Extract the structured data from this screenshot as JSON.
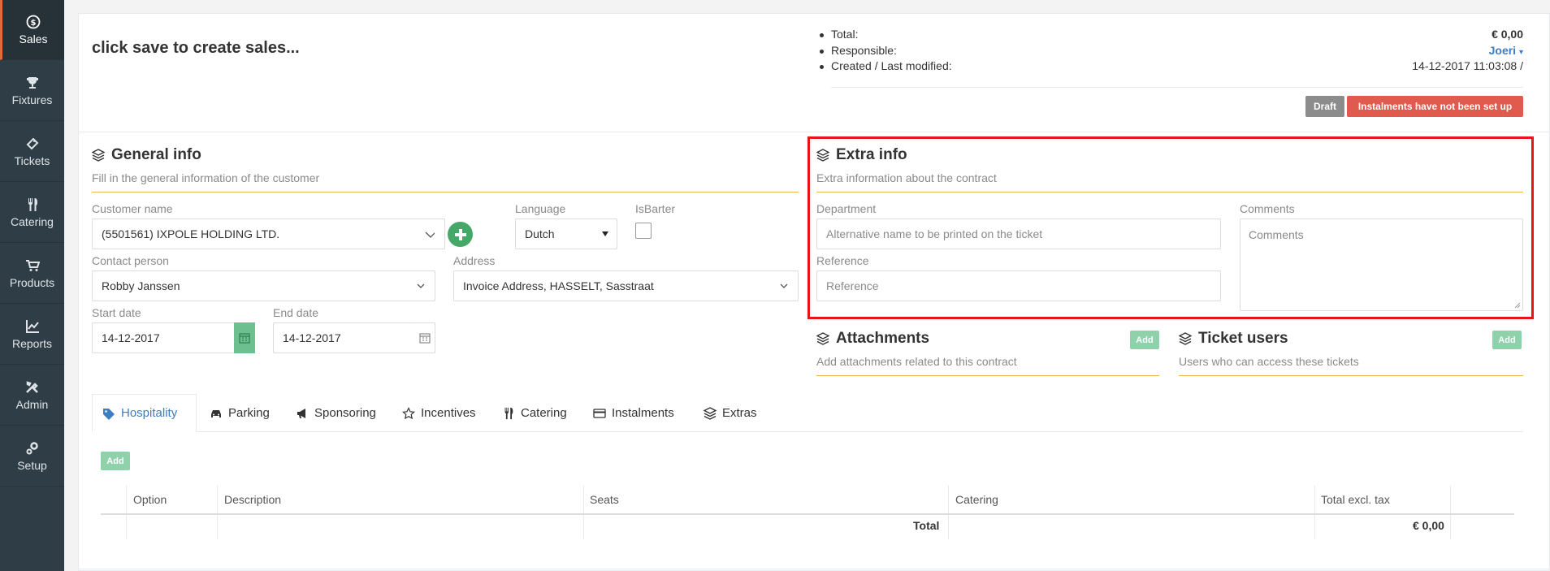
{
  "sidebar": {
    "items": [
      {
        "label": "Sales",
        "icon": "dollar-icon"
      },
      {
        "label": "Fixtures",
        "icon": "trophy-icon"
      },
      {
        "label": "Tickets",
        "icon": "ticket-icon"
      },
      {
        "label": "Catering",
        "icon": "cutlery-icon"
      },
      {
        "label": "Products",
        "icon": "cart-icon"
      },
      {
        "label": "Reports",
        "icon": "chart-icon"
      },
      {
        "label": "Admin",
        "icon": "tools-icon"
      },
      {
        "label": "Setup",
        "icon": "gears-icon"
      }
    ]
  },
  "header": {
    "title": "click save to create sales...",
    "summary": {
      "total_label": "Total:",
      "total_value": "€ 0,00",
      "responsible_label": "Responsible:",
      "responsible_value": "Joeri",
      "created_label": "Created / Last modified:",
      "created_value": "14-12-2017 11:03:08 /"
    },
    "badges": {
      "draft": "Draft",
      "instalments": "Instalments have not been set up"
    }
  },
  "general": {
    "title": "General info",
    "subtitle": "Fill in the general information of the customer",
    "customer_label": "Customer name",
    "customer_value": "(5501561) IXPOLE HOLDING LTD.",
    "language_label": "Language",
    "language_value": "Dutch",
    "isbarter_label": "IsBarter",
    "contact_label": "Contact person",
    "contact_value": "Robby Janssen",
    "address_label": "Address",
    "address_value": "Invoice Address, HASSELT, Sasstraat",
    "start_label": "Start date",
    "start_value": "14-12-2017",
    "end_label": "End date",
    "end_value": "14-12-2017"
  },
  "extra": {
    "title": "Extra info",
    "subtitle": "Extra information about the contract",
    "department_label": "Department",
    "department_placeholder": "Alternative name to be printed on the ticket",
    "reference_label": "Reference",
    "reference_placeholder": "Reference",
    "comments_label": "Comments",
    "comments_placeholder": "Comments"
  },
  "attachments": {
    "title": "Attachments",
    "subtitle": "Add attachments related to this contract",
    "add_label": "Add"
  },
  "ticket_users": {
    "title": "Ticket users",
    "subtitle": "Users who can access these tickets",
    "add_label": "Add"
  },
  "tabs": [
    {
      "label": "Hospitality",
      "icon": "tag-icon",
      "active": true
    },
    {
      "label": "Parking",
      "icon": "car-icon"
    },
    {
      "label": "Sponsoring",
      "icon": "bullhorn-icon"
    },
    {
      "label": "Incentives",
      "icon": "star-icon"
    },
    {
      "label": "Catering",
      "icon": "cutlery-icon"
    },
    {
      "label": "Instalments",
      "icon": "credit-card-icon"
    },
    {
      "label": "Extras",
      "icon": "layers-icon"
    }
  ],
  "table": {
    "add_label": "Add",
    "columns": [
      "Option",
      "Description",
      "Seats",
      "Catering",
      "Total excl. tax"
    ],
    "total_label": "Total",
    "total_value": "€ 0,00"
  },
  "colors": {
    "sidebar": "#2f3e46",
    "accent_orange": "#f0b54c",
    "link_blue": "#3c7dc4",
    "green": "#45a868",
    "danger": "#e05a4e",
    "highlight": "#e8141b"
  }
}
